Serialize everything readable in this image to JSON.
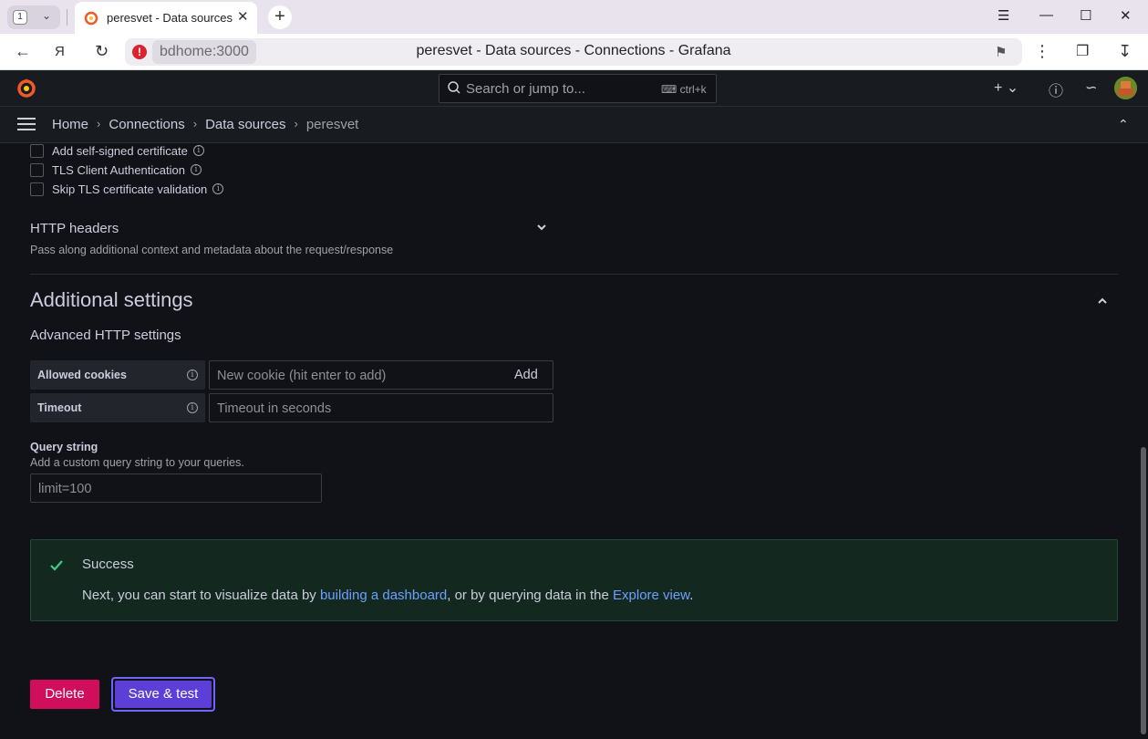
{
  "browser": {
    "tab_count": "1",
    "tab_title": "peresvet - Data sources - Connections - Grafana",
    "host": "bdhome:3000",
    "page_title": "peresvet - Data sources - Connections - Grafana"
  },
  "topbar": {
    "search_placeholder": "Search or jump to...",
    "shortcut": "ctrl+k"
  },
  "breadcrumb": [
    "Home",
    "Connections",
    "Data sources",
    "peresvet"
  ],
  "tls": {
    "items": [
      {
        "label": "Add self-signed certificate",
        "checked": false
      },
      {
        "label": "TLS Client Authentication",
        "checked": false
      },
      {
        "label": "Skip TLS certificate validation",
        "checked": false
      }
    ]
  },
  "http_headers": {
    "title": "HTTP headers",
    "description": "Pass along additional context and metadata about the request/response"
  },
  "additional": {
    "title": "Additional settings",
    "advanced_title": "Advanced HTTP settings",
    "allowed_cookies_label": "Allowed cookies",
    "cookie_placeholder": "New cookie (hit enter to add)",
    "add_label": "Add",
    "timeout_label": "Timeout",
    "timeout_placeholder": "Timeout in seconds",
    "query_string_label": "Query string",
    "query_string_desc": "Add a custom query string to your queries.",
    "query_string_placeholder": "limit=100"
  },
  "alert": {
    "title": "Success",
    "msg_pre": "Next, you can start to visualize data by ",
    "link1": "building a dashboard",
    "msg_mid": ", or by querying data in the ",
    "link2": "Explore view",
    "msg_post": "."
  },
  "actions": {
    "delete": "Delete",
    "save": "Save & test"
  },
  "colors": {
    "accent": "#6e9fff",
    "danger": "#d10e5c",
    "primary": "#5b3fd6",
    "success_bg": "#13291f"
  }
}
